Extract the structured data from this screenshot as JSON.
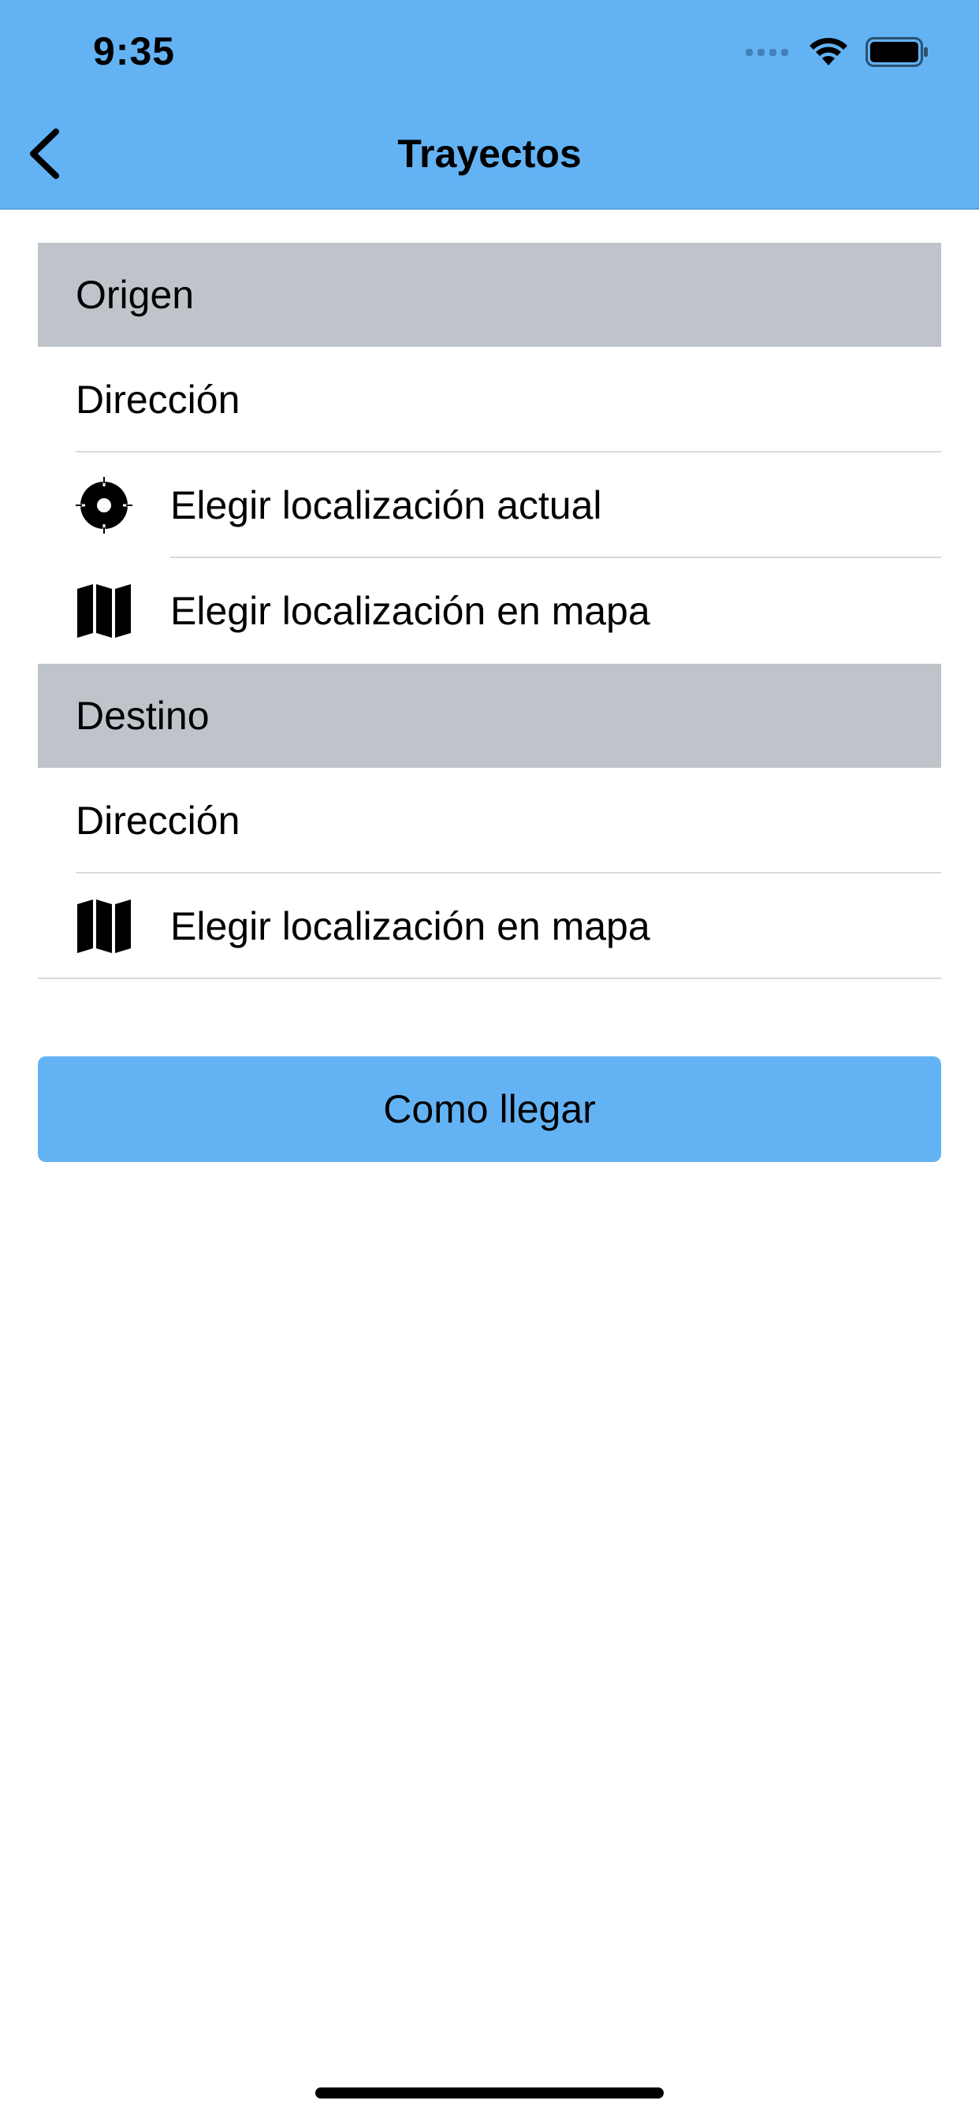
{
  "status_bar": {
    "time": "9:35",
    "icons": [
      "signal-icon",
      "wifi-icon",
      "battery-icon"
    ]
  },
  "nav": {
    "back_icon": "chevron-left-icon",
    "title": "Trayectos"
  },
  "origin": {
    "header": "Origen",
    "address_label": "Dirección",
    "current_location_label": "Elegir localización actual",
    "current_location_icon": "crosshair-icon",
    "map_location_label": "Elegir localización en mapa",
    "map_location_icon": "map-icon"
  },
  "destination": {
    "header": "Destino",
    "address_label": "Dirección",
    "map_location_label": "Elegir localización en mapa",
    "map_location_icon": "map-icon"
  },
  "actions": {
    "route_button": "Como llegar"
  },
  "colors": {
    "accent": "#63b3f4",
    "section_header": "#bec4ca",
    "separator": "#d9d9d9"
  }
}
